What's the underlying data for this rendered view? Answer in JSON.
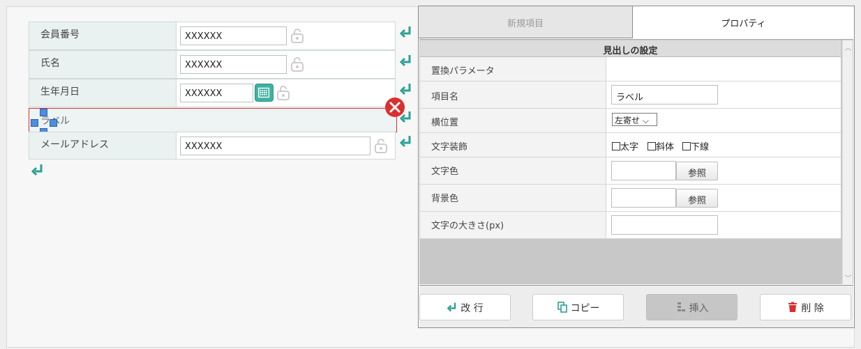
{
  "form": {
    "rows": [
      {
        "label": "会員番号",
        "value": "XXXXXX"
      },
      {
        "label": "氏名",
        "value": "XXXXXX"
      },
      {
        "label": "生年月日",
        "value": "XXXXXX"
      },
      {
        "label": "ラベル",
        "value": ""
      },
      {
        "label": "メールアドレス",
        "value": "XXXXXX"
      }
    ]
  },
  "tabs": {
    "new_item": "新規項目",
    "properties": "プロパティ"
  },
  "properties": {
    "section_title": "見出しの設定",
    "replace_param": {
      "label": "置換パラメータ",
      "value": ""
    },
    "item_name": {
      "label": "項目名",
      "value": "ラベル"
    },
    "horizontal_position": {
      "label": "横位置",
      "selected": "左寄せ"
    },
    "text_decoration": {
      "label": "文字装飾",
      "bold": "太字",
      "italic": "斜体",
      "underline": "下線"
    },
    "text_color": {
      "label": "文字色",
      "value": "",
      "browse": "参照"
    },
    "bg_color": {
      "label": "背景色",
      "value": "",
      "browse": "参照"
    },
    "font_size": {
      "label": "文字の大きさ(px)",
      "value": ""
    }
  },
  "actions": {
    "newline": "改 行",
    "copy": "コピー",
    "insert": "挿入",
    "delete": "削 除"
  },
  "colors": {
    "accent": "#2aa193",
    "danger": "#d9302f",
    "handle": "#4a8fe0"
  }
}
